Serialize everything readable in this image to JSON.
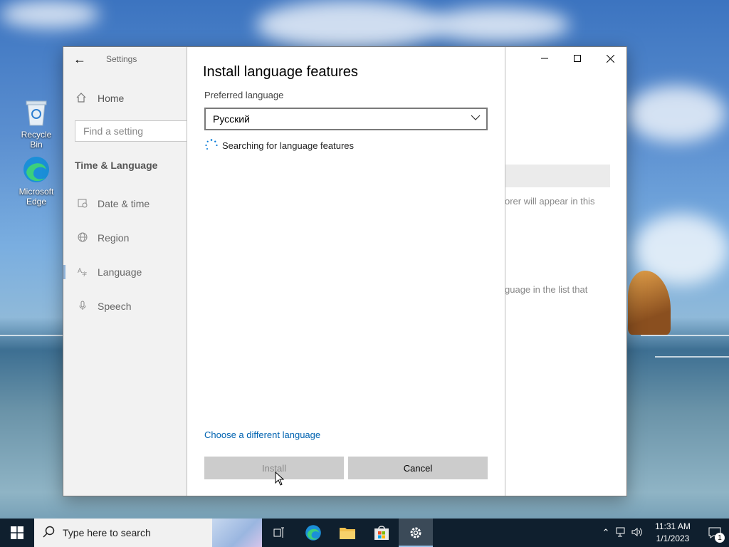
{
  "desktop": {
    "icons": [
      {
        "label": "Recycle Bin",
        "icon": "recycle-bin-icon"
      },
      {
        "label": "Microsoft Edge",
        "icon": "edge-icon"
      }
    ]
  },
  "settings_window": {
    "app_title": "Settings",
    "sidebar": {
      "home": "Home",
      "search_placeholder": "Find a setting",
      "section": "Time & Language",
      "items": [
        {
          "label": "Date & time",
          "icon": "calendar-clock-icon"
        },
        {
          "label": "Region",
          "icon": "globe-icon"
        },
        {
          "label": "Language",
          "icon": "language-icon",
          "selected": true
        },
        {
          "label": "Speech",
          "icon": "microphone-icon"
        }
      ]
    },
    "background_text": {
      "line1": "orer will appear in this",
      "line2": "guage in the list that"
    },
    "caption_buttons": [
      "minimize-icon",
      "maximize-icon",
      "close-icon"
    ]
  },
  "dialog": {
    "title": "Install language features",
    "preferred_label": "Preferred language",
    "selected_language": "Русский",
    "status": "Searching for language features",
    "choose_link": "Choose a different language",
    "install_label": "Install",
    "cancel_label": "Cancel"
  },
  "taskbar": {
    "search_placeholder": "Type here to search",
    "apps": [
      "task-view-icon",
      "edge-icon",
      "file-explorer-icon",
      "store-icon",
      "settings-gear-icon"
    ],
    "clock_time": "11:31 AM",
    "clock_date": "1/1/2023",
    "notification_count": "1"
  }
}
